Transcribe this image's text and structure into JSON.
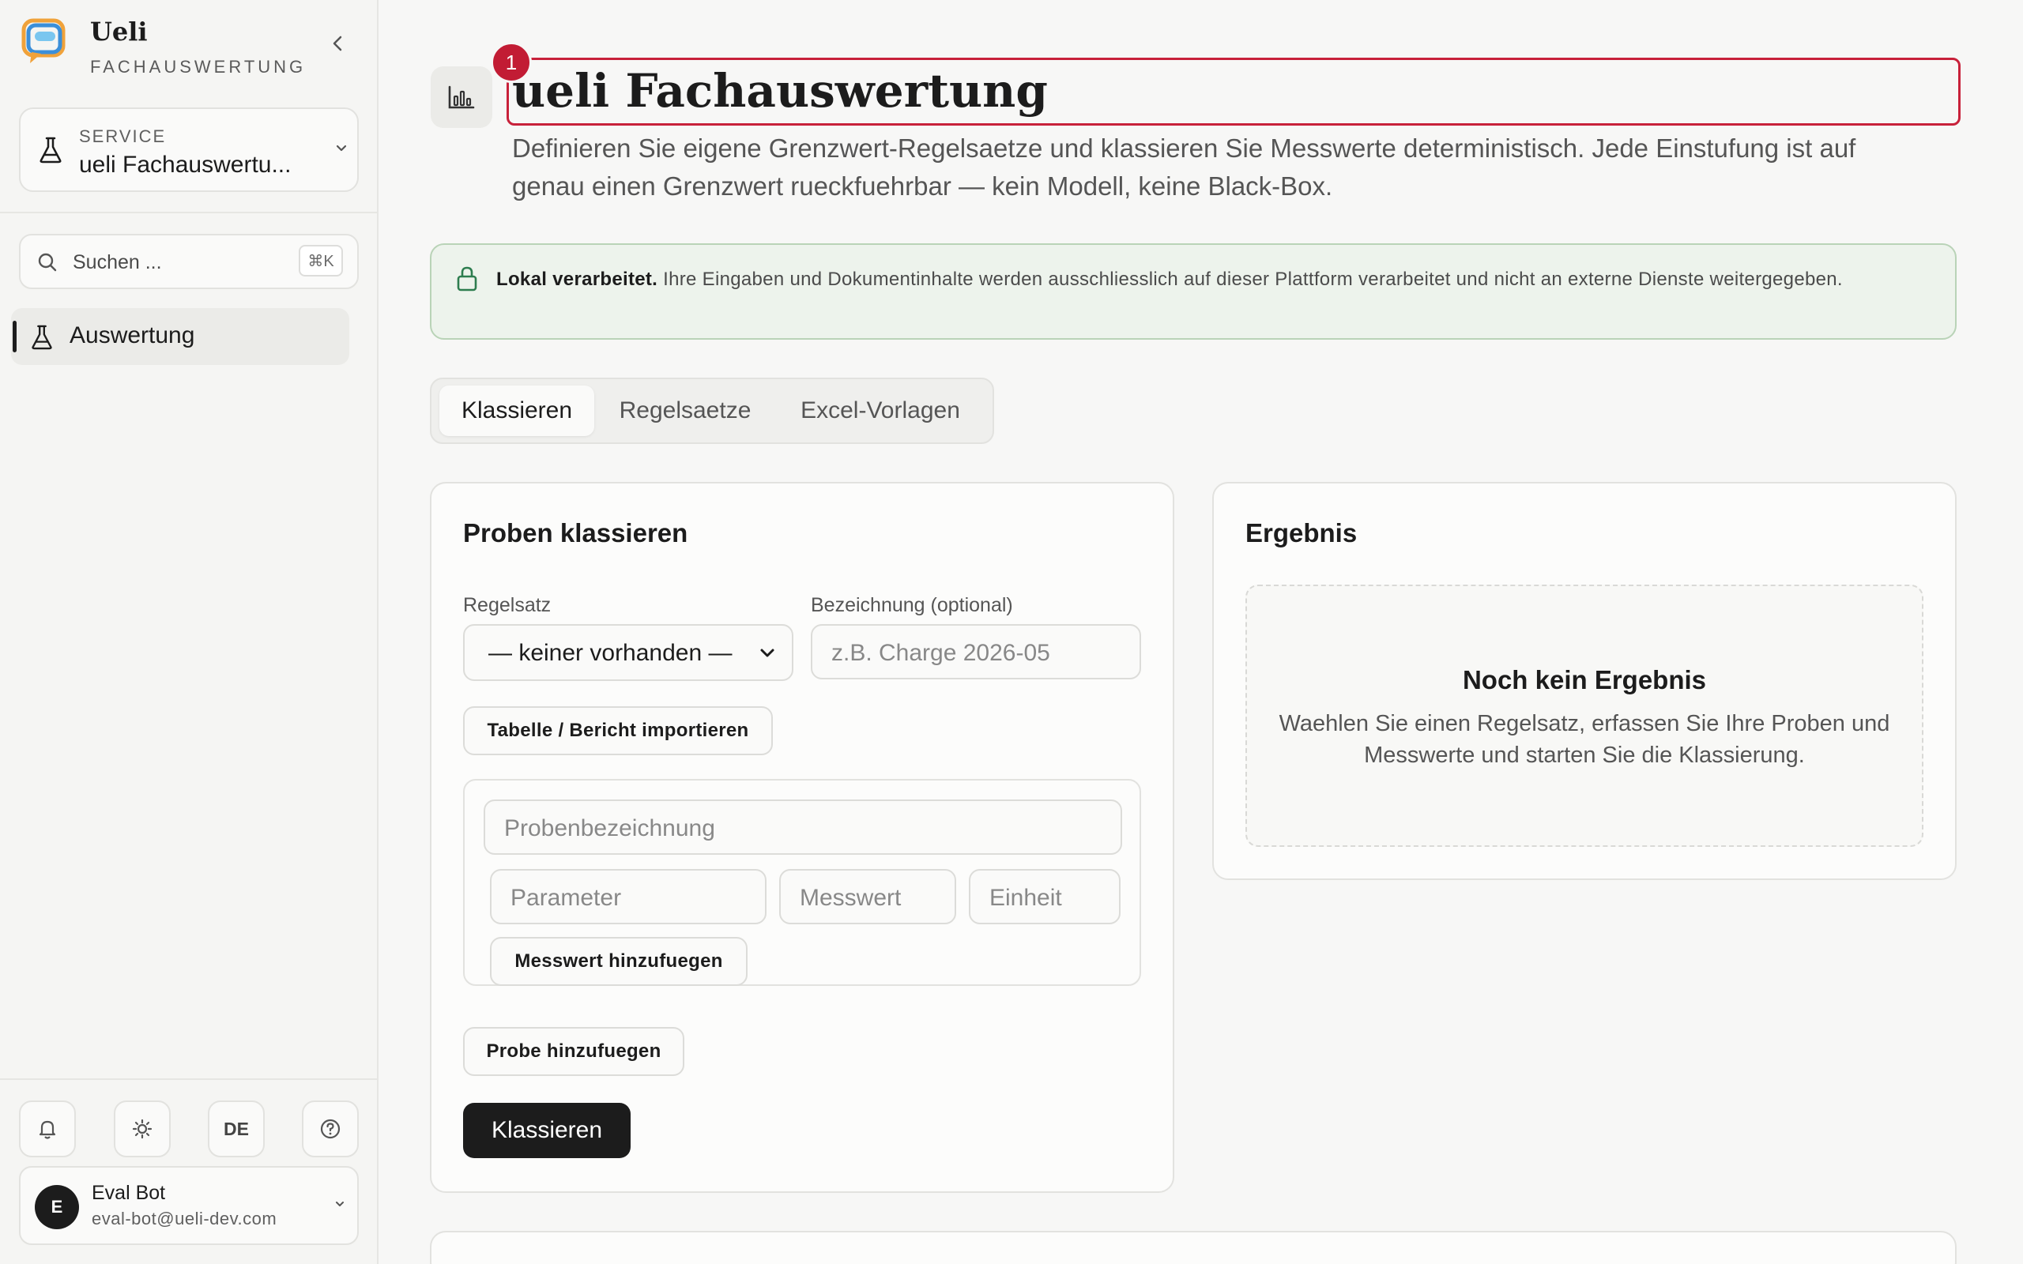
{
  "sidebar": {
    "brand_name": "Ueli",
    "brand_sub": "FACHAUSWERTUNG",
    "service_label": "SERVICE",
    "service_value": "ueli Fachauswertu...",
    "search_placeholder": "Suchen ...",
    "search_shortcut": "⌘K",
    "nav": [
      {
        "label": "Auswertung",
        "icon": "flask-icon",
        "active": true
      }
    ],
    "language": "DE",
    "user": {
      "initial": "E",
      "name": "Eval Bot",
      "email": "eval-bot@ueli-dev.com"
    }
  },
  "header": {
    "badge": "1",
    "title": "ueli Fachauswertung",
    "description": "Definieren Sie eigene Grenzwert-Regelsaetze und klassieren Sie Messwerte deterministisch. Jede Einstufung ist auf genau einen Grenzwert rueckfuehrbar — kein Modell, keine Black-Box."
  },
  "notice": {
    "bold": "Lokal verarbeitet.",
    "text": " Ihre Eingaben und Dokumentinhalte werden ausschliesslich auf dieser Plattform verarbeitet und nicht an externe Dienste weitergegeben."
  },
  "tabs": [
    {
      "label": "Klassieren",
      "active": true
    },
    {
      "label": "Regelsaetze",
      "active": false
    },
    {
      "label": "Excel-Vorlagen",
      "active": false
    }
  ],
  "classify": {
    "title": "Proben klassieren",
    "ruleset_label": "Regelsatz",
    "ruleset_value": "— keiner vorhanden —",
    "name_label": "Bezeichnung (optional)",
    "name_placeholder": "z.B. Charge 2026-05",
    "import_button": "Tabelle / Bericht importieren",
    "sample_placeholder": "Probenbezeichnung",
    "parameter_placeholder": "Parameter",
    "value_placeholder": "Messwert",
    "unit_placeholder": "Einheit",
    "add_measure_button": "Messwert hinzufuegen",
    "add_sample_button": "Probe hinzufuegen",
    "submit_button": "Klassieren"
  },
  "result": {
    "title": "Ergebnis",
    "empty_title": "Noch kein Ergebnis",
    "empty_text": "Waehlen Sie einen Regelsatz, erfassen Sie Ihre Proben und Messwerte und starten Sie die Klassierung."
  },
  "colors": {
    "accent_red": "#c21c34",
    "primary": "#1c1c1c",
    "notice_bg": "#edf3ec",
    "notice_icon": "#2e7d4f"
  }
}
